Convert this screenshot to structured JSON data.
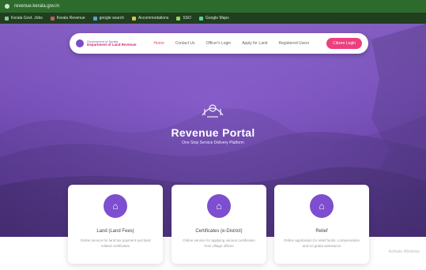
{
  "browser": {
    "url": "revenue.kerala.gov.in",
    "bookmarks": [
      {
        "label": "Kerala Govt. Jobs"
      },
      {
        "label": "Kerala Revenue"
      },
      {
        "label": "google search"
      },
      {
        "label": "Accommodations"
      },
      {
        "label": "SSO"
      },
      {
        "label": "Google Maps"
      }
    ]
  },
  "header": {
    "brand_line1": "Government of Kerala",
    "brand_line2": "Department of Land Revenue",
    "menu": [
      "Home",
      "Contact Us",
      "Officer's Login",
      "Apply for Land",
      "Registered Users"
    ],
    "cta_label": "Citizen Login"
  },
  "hero": {
    "title": "Revenue Portal",
    "subtitle": "One Stop Service Delivery Platform"
  },
  "cards": [
    {
      "title": "Land (Land Fees)",
      "desc": "Online service for land tax payment and land related certificates"
    },
    {
      "title": "Certificates (e-District)",
      "desc": "Online service for applying various certificates from village offices"
    },
    {
      "title": "Relief",
      "desc": "Online application for relief funds, compensation and ex-gratia assistance"
    }
  ],
  "corner_text": "Activate Windows",
  "colors": {
    "accent": "#7d4ed0",
    "cta": "#ec3f7e",
    "hero": "#7d53bf"
  }
}
